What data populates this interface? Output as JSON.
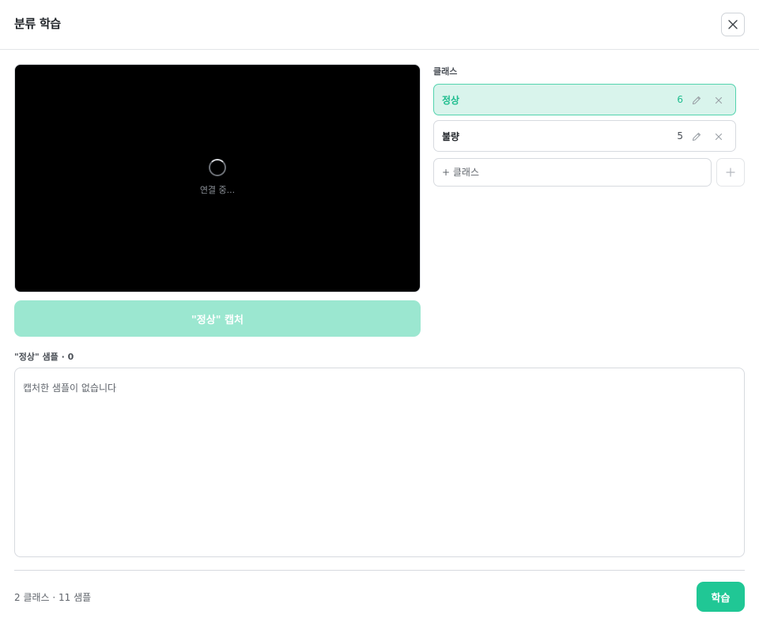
{
  "dialog": {
    "title": "분류 학습",
    "close_icon": "close-icon"
  },
  "camera": {
    "status_text": "연결 중..."
  },
  "capture": {
    "label": "\"정상\" 캡처"
  },
  "classes": {
    "label": "클래스",
    "items": [
      {
        "name": "정상",
        "count": "6",
        "active": true
      },
      {
        "name": "불량",
        "count": "5",
        "active": false
      }
    ],
    "add_placeholder": "+ 클래스",
    "add_icon": "plus-icon",
    "edit_icon": "pencil-icon",
    "delete_icon": "close-icon"
  },
  "samples": {
    "label": "\"정상\" 샘플 · 0",
    "empty_text": "캡처한 샘플이 없습니다"
  },
  "footer": {
    "summary": "2 클래스 · 11 샘플",
    "train_label": "학습"
  },
  "colors": {
    "accent": "#20c795",
    "accent_light": "#9be7d0",
    "active_bg": "#d9f4ec"
  }
}
